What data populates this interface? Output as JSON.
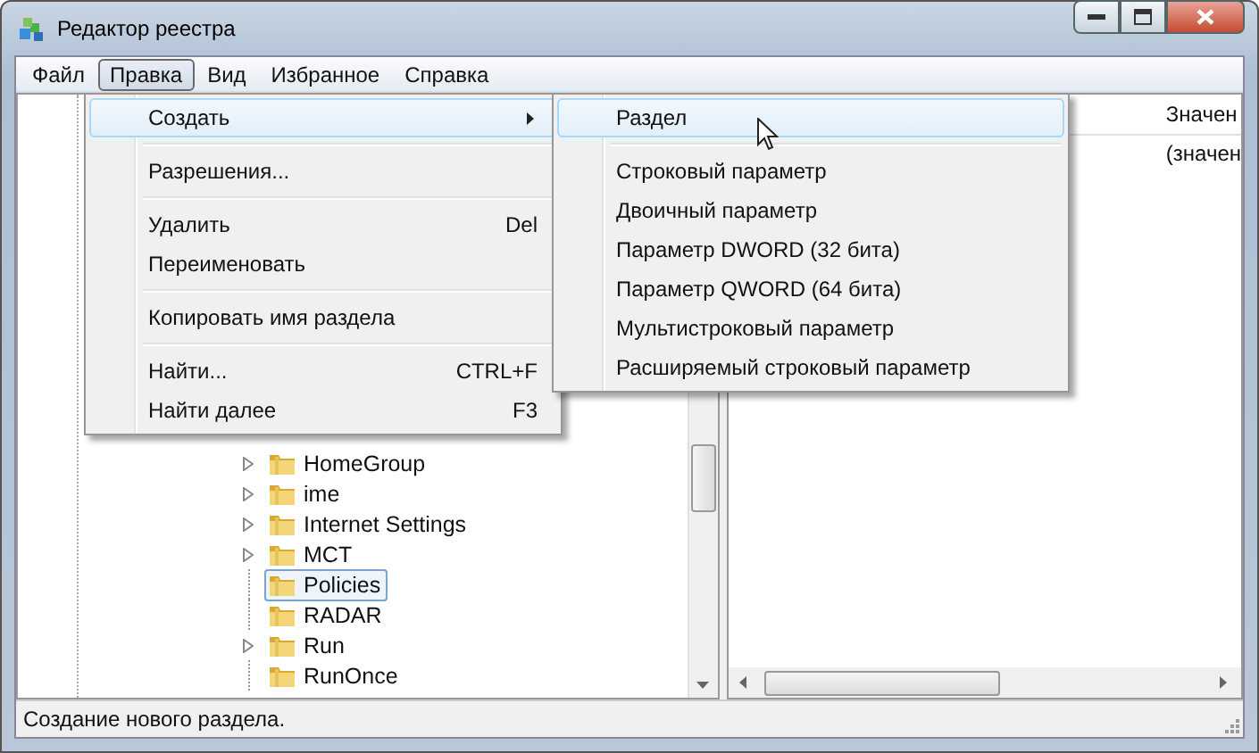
{
  "window": {
    "title": "Редактор реестра"
  },
  "menubar": [
    {
      "label": "Файл",
      "selected": false
    },
    {
      "label": "Правка",
      "selected": true
    },
    {
      "label": "Вид",
      "selected": false
    },
    {
      "label": "Избранное",
      "selected": false
    },
    {
      "label": "Справка",
      "selected": false
    }
  ],
  "tree": {
    "items": [
      {
        "label": "HomeGroup",
        "expandable": true,
        "selected": false
      },
      {
        "label": "ime",
        "expandable": true,
        "selected": false
      },
      {
        "label": "Internet Settings",
        "expandable": true,
        "selected": false
      },
      {
        "label": "MCT",
        "expandable": true,
        "selected": false
      },
      {
        "label": "Policies",
        "expandable": false,
        "selected": true
      },
      {
        "label": "RADAR",
        "expandable": false,
        "selected": false
      },
      {
        "label": "Run",
        "expandable": true,
        "selected": false
      },
      {
        "label": "RunOnce",
        "expandable": false,
        "selected": false
      }
    ]
  },
  "values_pane": {
    "column_header": "Значен",
    "rows": [
      "(значен"
    ]
  },
  "edit_menu": [
    {
      "kind": "item",
      "label": "Создать",
      "submenu": true,
      "selected": true
    },
    {
      "kind": "separator"
    },
    {
      "kind": "item",
      "label": "Разрешения...",
      "selected": false
    },
    {
      "kind": "separator"
    },
    {
      "kind": "item",
      "label": "Удалить",
      "shortcut": "Del",
      "selected": false
    },
    {
      "kind": "item",
      "label": "Переименовать",
      "selected": false
    },
    {
      "kind": "separator"
    },
    {
      "kind": "item",
      "label": "Копировать имя раздела",
      "selected": false
    },
    {
      "kind": "separator"
    },
    {
      "kind": "item",
      "label": "Найти...",
      "shortcut": "CTRL+F",
      "selected": false
    },
    {
      "kind": "item",
      "label": "Найти далее",
      "shortcut": "F3",
      "selected": false
    }
  ],
  "create_submenu": [
    {
      "kind": "item",
      "label": "Раздел",
      "selected": true
    },
    {
      "kind": "separator"
    },
    {
      "kind": "item",
      "label": "Строковый параметр",
      "selected": false
    },
    {
      "kind": "item",
      "label": "Двоичный параметр",
      "selected": false
    },
    {
      "kind": "item",
      "label": "Параметр DWORD (32 бита)",
      "selected": false
    },
    {
      "kind": "item",
      "label": "Параметр QWORD (64 бита)",
      "selected": false
    },
    {
      "kind": "item",
      "label": "Мультистроковый параметр",
      "selected": false
    },
    {
      "kind": "item",
      "label": "Расширяемый строковый параметр",
      "selected": false
    }
  ],
  "status_bar": "Создание нового раздела."
}
